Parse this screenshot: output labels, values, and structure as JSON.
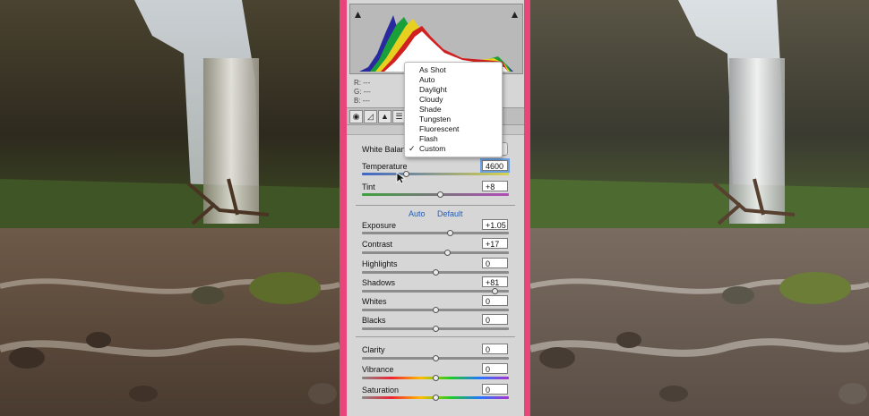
{
  "histogram": {
    "rgb_labels": [
      "R:",
      "G:",
      "B:"
    ],
    "rgb_values": [
      "---",
      "---",
      "---"
    ]
  },
  "panel": {
    "white_balance_label": "White Balance",
    "auto_link": "Auto",
    "default_link": "Default",
    "sliders": [
      {
        "label": "Temperature",
        "value": "4600",
        "level": 0.3
      },
      {
        "label": "Tint",
        "value": "+8",
        "level": 0.53
      },
      {
        "label": "Exposure",
        "value": "+1.05",
        "level": 0.6
      },
      {
        "label": "Contrast",
        "value": "+17",
        "level": 0.58
      },
      {
        "label": "Highlights",
        "value": "0",
        "level": 0.5
      },
      {
        "label": "Shadows",
        "value": "+81",
        "level": 0.9
      },
      {
        "label": "Whites",
        "value": "0",
        "level": 0.5
      },
      {
        "label": "Blacks",
        "value": "0",
        "level": 0.5
      },
      {
        "label": "Clarity",
        "value": "0",
        "level": 0.5
      },
      {
        "label": "Vibrance",
        "value": "0",
        "level": 0.5
      },
      {
        "label": "Saturation",
        "value": "0",
        "level": 0.5
      }
    ]
  },
  "wb_menu": {
    "items": [
      "As Shot",
      "Auto",
      "Daylight",
      "Cloudy",
      "Shade",
      "Tungsten",
      "Fluorescent",
      "Flash",
      "Custom"
    ],
    "checked_mark": "✓"
  },
  "colors": {
    "frame": "#e8457a",
    "panel": "#d6d6d6",
    "link": "#1f5fbf"
  }
}
